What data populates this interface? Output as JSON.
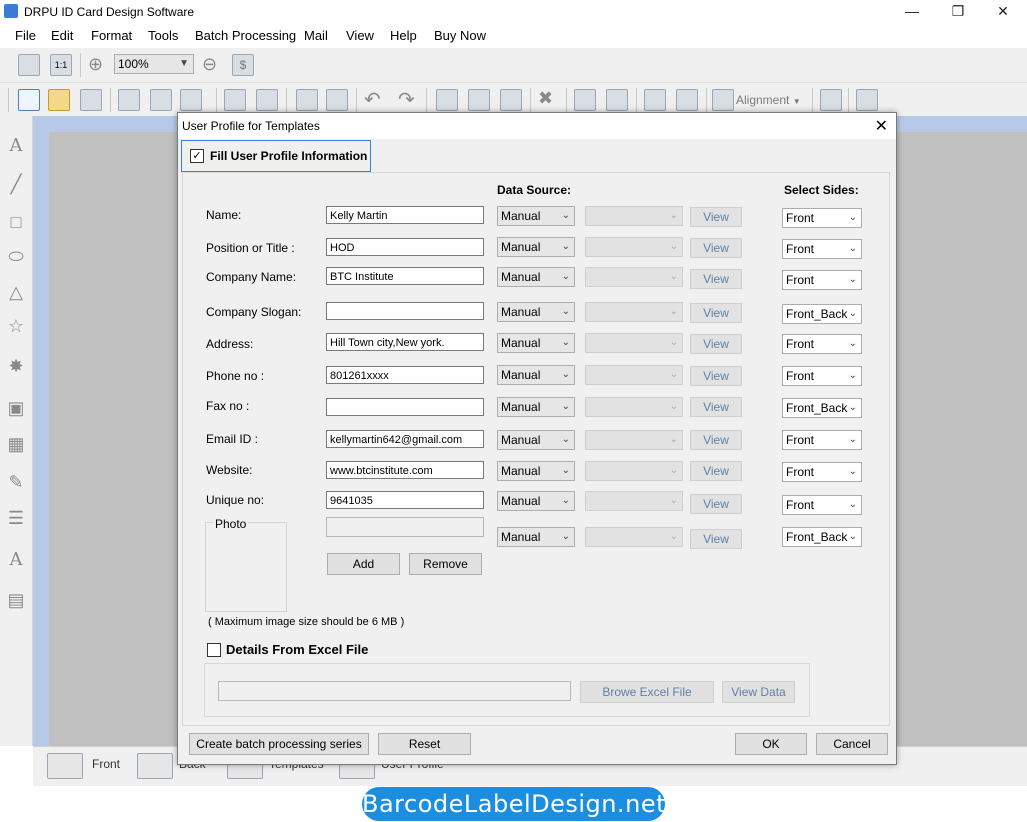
{
  "app": {
    "title": "DRPU ID Card Design Software",
    "window_controls": [
      "minimize",
      "maximize",
      "close"
    ]
  },
  "menu": [
    "File",
    "Edit",
    "Format",
    "Tools",
    "Batch Processing",
    "Mail",
    "View",
    "Help",
    "Buy Now"
  ],
  "toolbar": {
    "zoom_value": "100%",
    "alignment_label": "Alignment"
  },
  "left_tools": [
    "text-tool-icon",
    "line-tool-icon",
    "rectangle-tool-icon",
    "ellipse-tool-icon",
    "triangle-tool-icon",
    "star-tool-icon",
    "shape-tool-icon",
    "image-tool-icon",
    "library-tool-icon",
    "signature-tool-icon",
    "barcode-tool-icon",
    "watermark-tool-icon",
    "card-tool-icon"
  ],
  "bottom_tabs": [
    "Front",
    "Back",
    "Templates",
    "User Profile"
  ],
  "brand": "BarcodeLabelDesign.net",
  "dialog": {
    "title": "User Profile for Templates",
    "fill_checkbox_label": "Fill User Profile Information",
    "fill_checked": true,
    "data_source_header": "Data Source:",
    "select_sides_header": "Select Sides:",
    "view_label": "View",
    "fields": [
      {
        "label": "Name:",
        "value": "Kelly Martin",
        "source": "Manual",
        "side": "Front"
      },
      {
        "label": "Position or Title :",
        "value": "HOD",
        "source": "Manual",
        "side": "Front"
      },
      {
        "label": "Company Name:",
        "value": "BTC Institute",
        "source": "Manual",
        "side": "Front"
      },
      {
        "label": "Company Slogan:",
        "value": "",
        "source": "Manual",
        "side": "Front_Back"
      },
      {
        "label": "Address:",
        "value": "Hill Town city,New york.",
        "source": "Manual",
        "side": "Front"
      },
      {
        "label": "Phone no :",
        "value": "801261xxxx",
        "source": "Manual",
        "side": "Front"
      },
      {
        "label": "Fax no :",
        "value": "",
        "source": "Manual",
        "side": "Front_Back"
      },
      {
        "label": "Email ID :",
        "value": "kellymartin642@gmail.com",
        "source": "Manual",
        "side": "Front"
      },
      {
        "label": "Website:",
        "value": "www.btcinstitute.com",
        "source": "Manual",
        "side": "Front"
      },
      {
        "label": "Unique no:",
        "value": "9641035",
        "source": "Manual",
        "side": "Front"
      }
    ],
    "photo": {
      "label": "Photo",
      "source": "Manual",
      "side": "Front_Back",
      "add_label": "Add",
      "remove_label": "Remove",
      "note": "( Maximum image size should be 6 MB )"
    },
    "excel": {
      "checkbox_label": "Details From Excel File",
      "checked": false,
      "browse_label": "Browe Excel File",
      "view_data_label": "View Data"
    },
    "buttons": {
      "batch": "Create batch processing series",
      "reset": "Reset",
      "ok": "OK",
      "cancel": "Cancel"
    }
  }
}
